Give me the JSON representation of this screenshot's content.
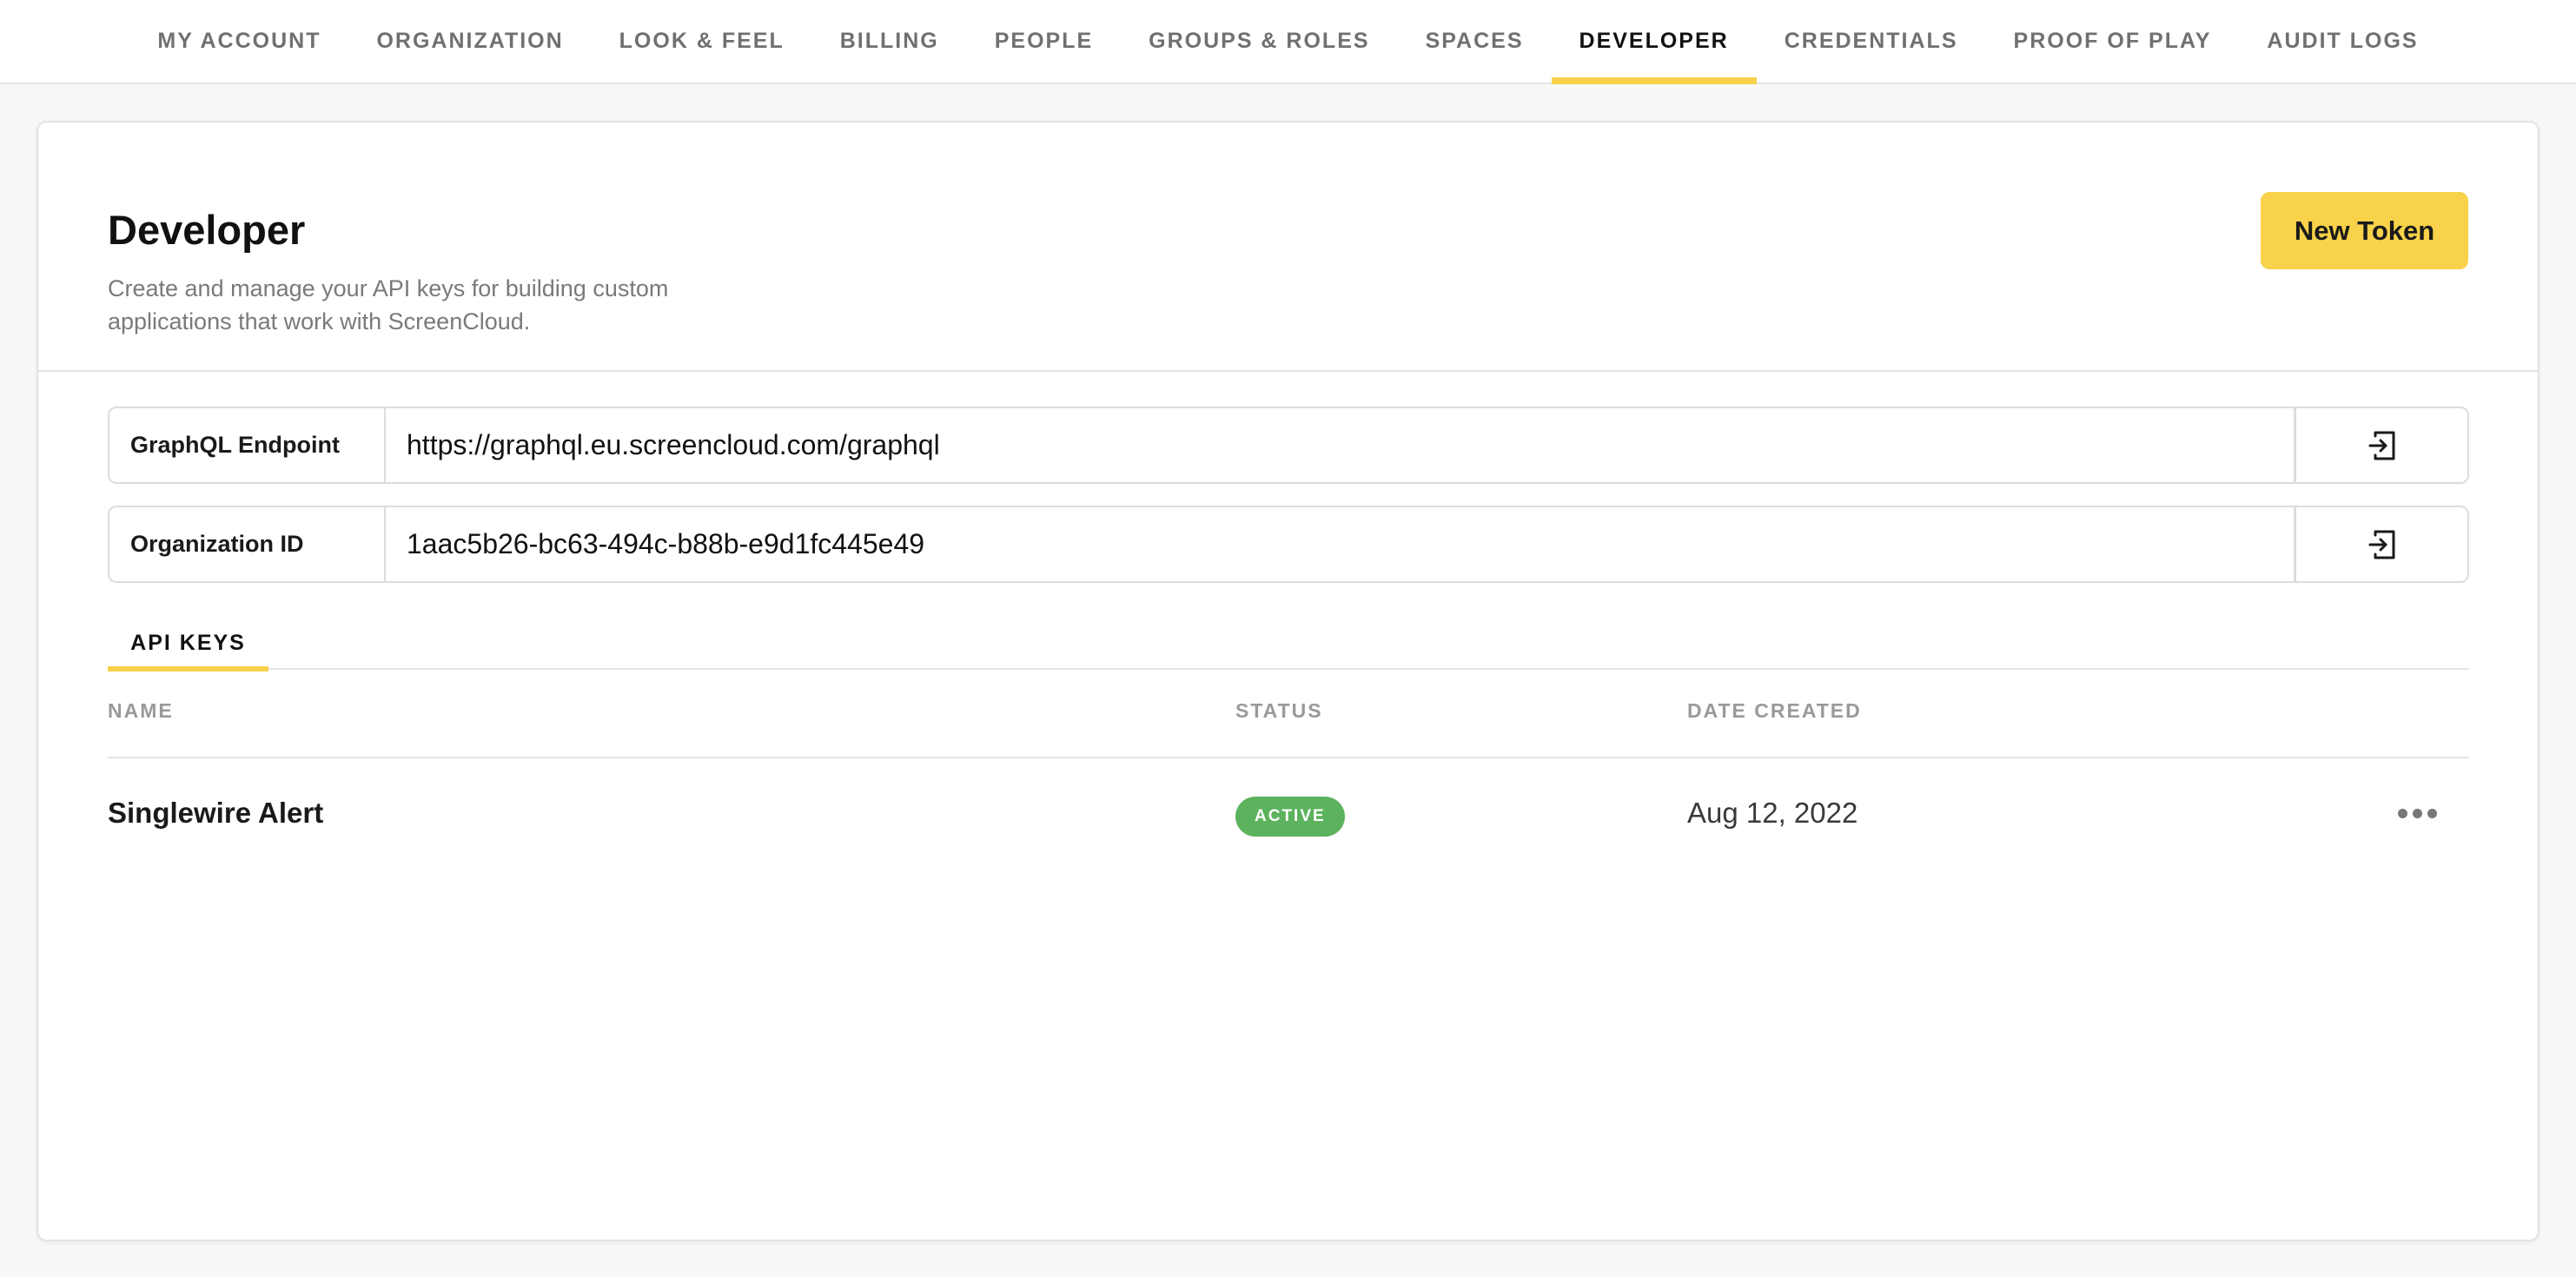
{
  "nav": {
    "tabs": [
      {
        "label": "MY ACCOUNT"
      },
      {
        "label": "ORGANIZATION"
      },
      {
        "label": "LOOK & FEEL"
      },
      {
        "label": "BILLING"
      },
      {
        "label": "PEOPLE"
      },
      {
        "label": "GROUPS & ROLES"
      },
      {
        "label": "SPACES"
      },
      {
        "label": "DEVELOPER"
      },
      {
        "label": "CREDENTIALS"
      },
      {
        "label": "PROOF OF PLAY"
      },
      {
        "label": "AUDIT LOGS"
      }
    ],
    "active": "DEVELOPER"
  },
  "header": {
    "title": "Developer",
    "description": "Create and manage your API keys for building custom applications that work with ScreenCloud.",
    "new_token_label": "New Token"
  },
  "fields": {
    "graphql": {
      "label": "GraphQL Endpoint",
      "value": "https://graphql.eu.screencloud.com/graphql",
      "icon": "copy-icon"
    },
    "org_id": {
      "label": "Organization ID",
      "value": "1aac5b26-bc63-494c-b88b-e9d1fc445e49",
      "icon": "copy-icon"
    }
  },
  "subtabs": {
    "api_keys": "API KEYS"
  },
  "table": {
    "columns": {
      "name": "NAME",
      "status": "STATUS",
      "date": "DATE CREATED"
    },
    "rows": [
      {
        "name": "Singlewire Alert",
        "status": "ACTIVE",
        "date": "Aug 12, 2022",
        "actions_icon": "more-horizontal-icon"
      }
    ]
  },
  "colors": {
    "accent": "#f8d24a",
    "status_active": "#5cb25d",
    "muted_text": "#7a7a7a"
  }
}
